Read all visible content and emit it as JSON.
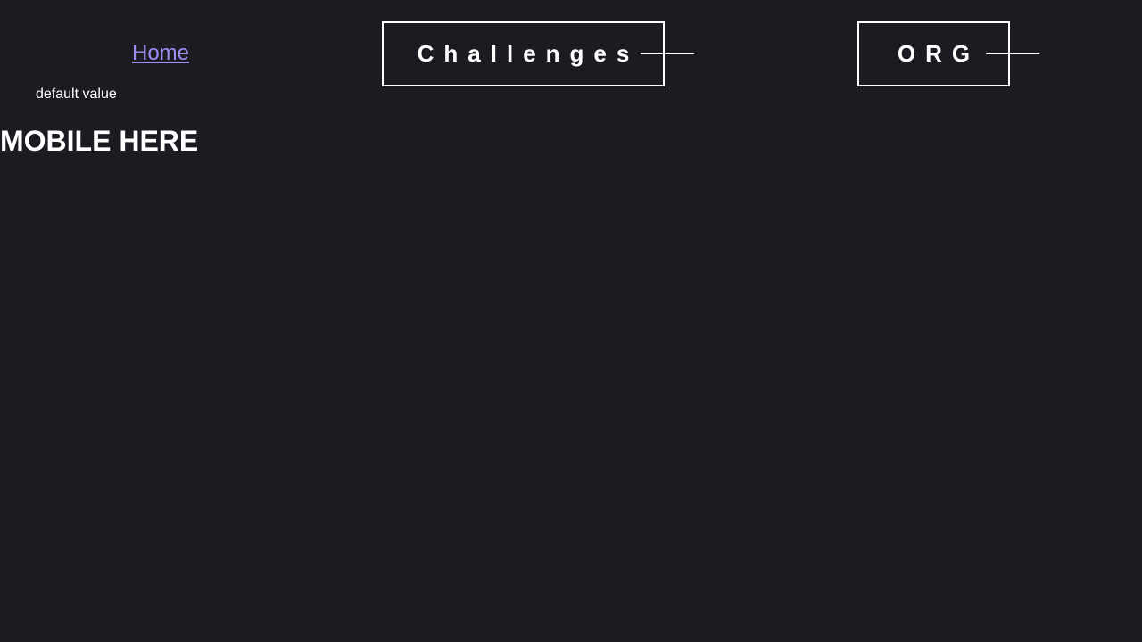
{
  "nav": {
    "home_label": "Home",
    "challenges_label": "Challenges",
    "org_label": "ORG"
  },
  "default_value_text": "default value",
  "main": {
    "heading": "MOBILE HERE"
  },
  "colors": {
    "background": "#1c1b21",
    "link": "#9a8cf0",
    "text": "#ffffff"
  }
}
